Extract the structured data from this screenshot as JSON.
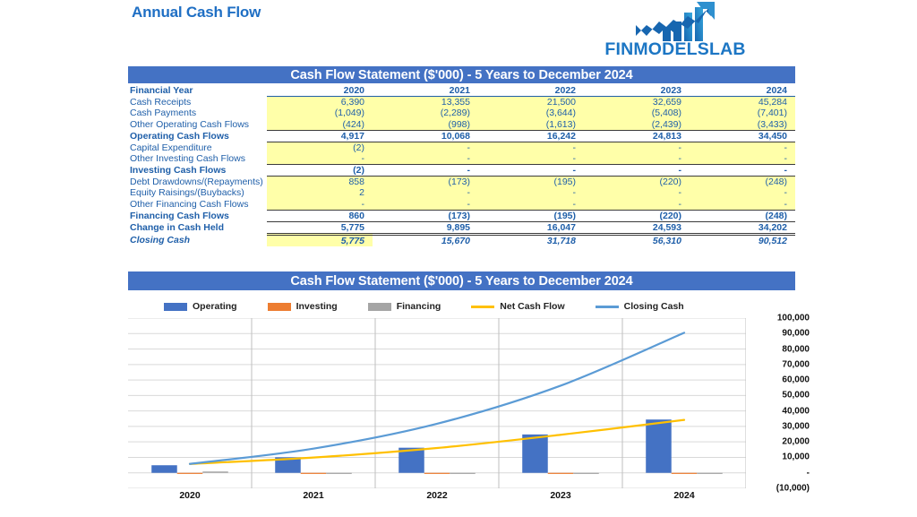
{
  "header": {
    "page_title": "Annual Cash Flow",
    "brand_text": "FINMODELSLAB",
    "brand_icon": "bar-chart-arrow-up-icon",
    "title_color": "#1F6FC4",
    "brand_color": "#1C76C4"
  },
  "banners": {
    "table_title": "Cash Flow Statement ($'000) - 5 Years to December 2024",
    "chart_title": "Cash Flow Statement ($'000) - 5 Years to December 2024",
    "color": "#4472C4"
  },
  "table": {
    "row_header_label": "Financial Year",
    "years": [
      "2020",
      "2021",
      "2022",
      "2023",
      "2024"
    ],
    "rows": [
      {
        "label": "Cash Receipts",
        "type": "item",
        "values": [
          "6,390",
          "13,355",
          "21,500",
          "32,659",
          "45,284"
        ]
      },
      {
        "label": "Cash Payments",
        "type": "item",
        "values": [
          "(1,049)",
          "(2,289)",
          "(3,644)",
          "(5,408)",
          "(7,401)"
        ]
      },
      {
        "label": "Other Operating Cash Flows",
        "type": "item",
        "values": [
          "(424)",
          "(998)",
          "(1,613)",
          "(2,439)",
          "(3,433)"
        ]
      },
      {
        "label": "Operating Cash Flows",
        "type": "total",
        "values": [
          "4,917",
          "10,068",
          "16,242",
          "24,813",
          "34,450"
        ]
      },
      {
        "label": "Capital Expenditure",
        "type": "item",
        "values": [
          "(2)",
          "-",
          "-",
          "-",
          "-"
        ]
      },
      {
        "label": "Other Investing Cash Flows",
        "type": "item",
        "values": [
          "-",
          "-",
          "-",
          "-",
          "-"
        ]
      },
      {
        "label": "Investing Cash Flows",
        "type": "total",
        "values": [
          "(2)",
          "-",
          "-",
          "-",
          "-"
        ]
      },
      {
        "label": "Debt Drawdowns/(Repayments)",
        "type": "item",
        "values": [
          "858",
          "(173)",
          "(195)",
          "(220)",
          "(248)"
        ]
      },
      {
        "label": "Equity Raisings/(Buybacks)",
        "type": "item",
        "values": [
          "2",
          "-",
          "-",
          "-",
          "-"
        ]
      },
      {
        "label": "Other Financing Cash Flows",
        "type": "item",
        "values": [
          "-",
          "-",
          "-",
          "-",
          "-"
        ]
      },
      {
        "label": "Financing Cash Flows",
        "type": "total",
        "values": [
          "860",
          "(173)",
          "(195)",
          "(220)",
          "(248)"
        ]
      },
      {
        "label": "Change in Cash Held",
        "type": "grand",
        "values": [
          "5,775",
          "9,895",
          "16,047",
          "24,593",
          "34,202"
        ]
      },
      {
        "label": "Closing Cash",
        "type": "closing",
        "values": [
          "5,775",
          "15,670",
          "31,718",
          "56,310",
          "90,512"
        ]
      }
    ]
  },
  "chart_data": {
    "type": "bar",
    "title": "Cash Flow Statement ($'000) - 5 Years to December 2024",
    "xlabel": "",
    "ylabel": "",
    "categories": [
      "2020",
      "2021",
      "2022",
      "2023",
      "2024"
    ],
    "ylim": [
      -10000,
      100000
    ],
    "yticks": [
      100000,
      90000,
      80000,
      70000,
      60000,
      50000,
      40000,
      30000,
      20000,
      10000,
      0,
      -10000
    ],
    "ytick_labels": [
      "100,000",
      "90,000",
      "80,000",
      "70,000",
      "60,000",
      "50,000",
      "40,000",
      "30,000",
      "20,000",
      "10,000",
      "-",
      "(10,000)"
    ],
    "grid": true,
    "legend_position": "top",
    "series": [
      {
        "name": "Operating",
        "kind": "bar",
        "color": "#4472C4",
        "values": [
          4917,
          10068,
          16242,
          24813,
          34450
        ]
      },
      {
        "name": "Investing",
        "kind": "bar",
        "color": "#ED7D31",
        "values": [
          -2,
          0,
          0,
          0,
          0
        ]
      },
      {
        "name": "Financing",
        "kind": "bar",
        "color": "#A5A5A5",
        "values": [
          860,
          -173,
          -195,
          -220,
          -248
        ]
      },
      {
        "name": "Net Cash Flow",
        "kind": "line",
        "color": "#FFC000",
        "values": [
          5775,
          9895,
          16047,
          24593,
          34202
        ]
      },
      {
        "name": "Closing Cash",
        "kind": "line",
        "color": "#5B9BD5",
        "values": [
          5775,
          15670,
          31718,
          56310,
          90512
        ]
      }
    ]
  }
}
